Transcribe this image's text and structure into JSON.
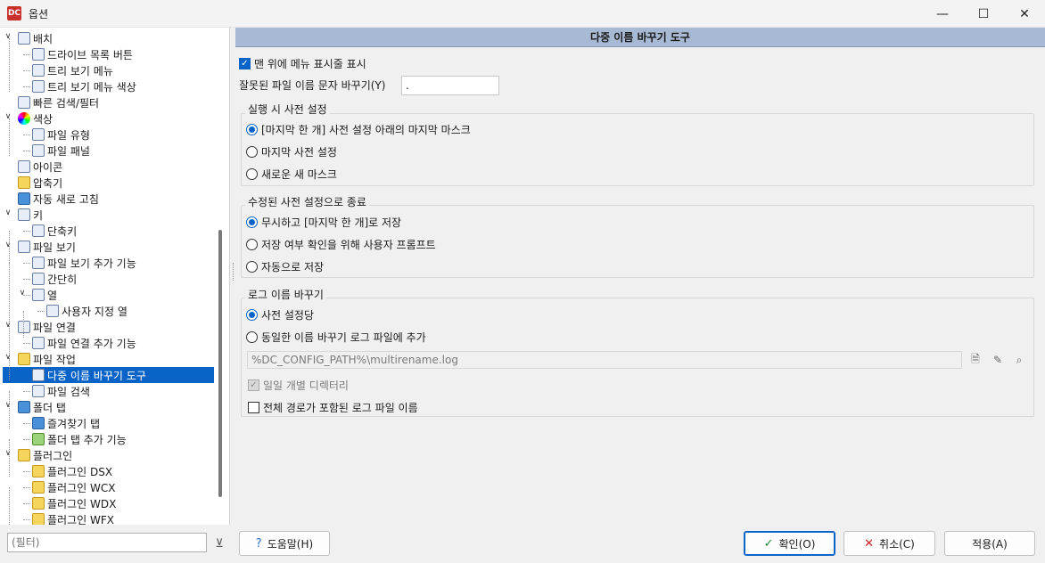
{
  "window": {
    "title": "옵션",
    "app_icon_text": "DC",
    "minimize_glyph": "—",
    "maximize_glyph": "☐",
    "close_glyph": "✕"
  },
  "tree": [
    {
      "label": "배치",
      "icon": "layout-icon",
      "expanded": true
    },
    {
      "label": "드라이브 목록 버튼",
      "icon": "drive-list-icon"
    },
    {
      "label": "트리 보기 메뉴",
      "icon": "tree-menu-icon"
    },
    {
      "label": "트리 보기 메뉴 색상",
      "icon": "tree-menu-color-icon"
    },
    {
      "label": "빠른 검색/필터",
      "icon": "quick-search-icon"
    },
    {
      "label": "색상",
      "icon": "color-wheel-icon",
      "expanded": true
    },
    {
      "label": "파일 유형",
      "icon": "file-type-icon"
    },
    {
      "label": "파일 패널",
      "icon": "file-panel-icon"
    },
    {
      "label": "아이콘",
      "icon": "footprint-icon"
    },
    {
      "label": "압축기",
      "icon": "archiver-icon"
    },
    {
      "label": "자동 새로 고침",
      "icon": "refresh-icon"
    },
    {
      "label": "키",
      "icon": "keyboard-icon",
      "expanded": true
    },
    {
      "label": "단축키",
      "icon": "hotkey-icon"
    },
    {
      "label": "파일 보기",
      "icon": "files-view-icon",
      "expanded": true
    },
    {
      "label": "파일 보기 추가 기능",
      "icon": "files-view-extra-icon"
    },
    {
      "label": "간단히",
      "icon": "brief-view-icon"
    },
    {
      "label": "열",
      "icon": "columns-icon",
      "expanded": true
    },
    {
      "label": "사용자 지정 열",
      "icon": "custom-columns-icon"
    },
    {
      "label": "파일 연결",
      "icon": "file-assoc-icon",
      "expanded": true
    },
    {
      "label": "파일 연결 추가 기능",
      "icon": "file-assoc-extra-icon"
    },
    {
      "label": "파일 작업",
      "icon": "file-operations-icon",
      "expanded": true
    },
    {
      "label": "다중 이름 바꾸기 도구",
      "icon": "multi-rename-icon",
      "selected": true
    },
    {
      "label": "파일 검색",
      "icon": "binoculars-icon"
    },
    {
      "label": "폴더 탭",
      "icon": "folder-tabs-icon",
      "expanded": true
    },
    {
      "label": "즐겨찾기 탭",
      "icon": "favorite-tabs-icon"
    },
    {
      "label": "폴더 탭 추가 기능",
      "icon": "folder-tabs-extra-icon"
    },
    {
      "label": "플러그인",
      "icon": "plugin-icon",
      "expanded": true
    },
    {
      "label": "플러그인 DSX",
      "icon": "plugin-dsx-icon"
    },
    {
      "label": "플러그인 WCX",
      "icon": "plugin-wcx-icon"
    },
    {
      "label": "플러그인 WDX",
      "icon": "plugin-wdx-icon"
    },
    {
      "label": "플러그인 WFX",
      "icon": "plugin-wfx-icon"
    }
  ],
  "filter": {
    "placeholder": "(필터)"
  },
  "panel": {
    "header": "다중 이름 바꾸기 도구",
    "show_menu_label": "맨 위에 메뉴 표시줄 표시",
    "show_menu_checked": true,
    "invalid_chars_label": "잘못된 파일 이름 문자 바꾸기(Y)",
    "invalid_chars_value": ".",
    "preset_group": {
      "title": "실행 시 사전 설정",
      "options": [
        {
          "label": "[마지막 한 개] 사전 설정 아래의 마지막 마스크",
          "checked": true
        },
        {
          "label": "마지막 사전 설정",
          "checked": false
        },
        {
          "label": "새로운 새 마스크",
          "checked": false
        }
      ]
    },
    "exit_group": {
      "title": "수정된 사전 설정으로 종료",
      "options": [
        {
          "label": "무시하고 [마지막 한 개]로 저장",
          "checked": true
        },
        {
          "label": "저장 여부 확인을 위해 사용자 프롬프트",
          "checked": false
        },
        {
          "label": "자동으로 저장",
          "checked": false
        }
      ]
    },
    "log_group": {
      "title": "로그 이름 바꾸기",
      "options": [
        {
          "label": "사전 설정당",
          "checked": true
        },
        {
          "label": "동일한 이름 바꾸기 로그 파일에 추가",
          "checked": false
        }
      ],
      "log_path": "%DC_CONFIG_PATH%\\multirename.log",
      "daily_dir_label": "일일 개별 디렉터리",
      "daily_dir_checked": true,
      "fullpath_label": "전체 경로가 포함된 로그 파일 이름",
      "fullpath_checked": false
    }
  },
  "buttons": {
    "help": "도움말(H)",
    "ok": "확인(O)",
    "cancel": "취소(C)",
    "apply": "적용(A)"
  }
}
